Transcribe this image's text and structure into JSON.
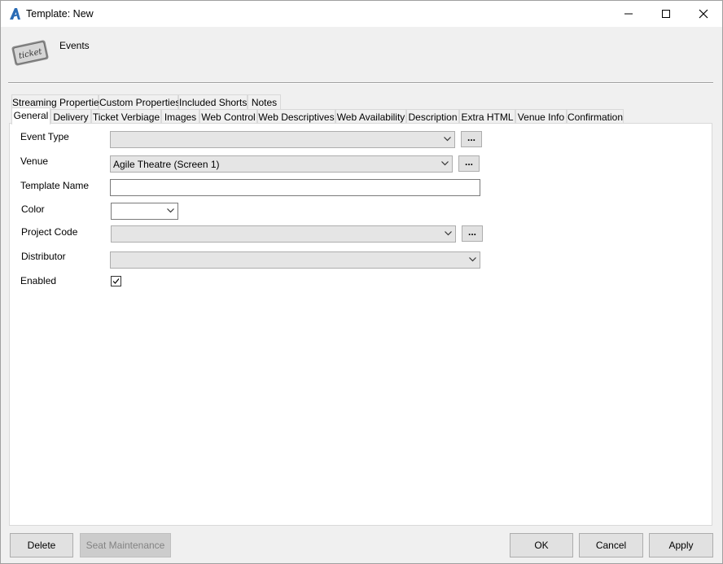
{
  "window": {
    "title": "Template: New",
    "controls": {
      "minimize": "minimize",
      "maximize": "maximize",
      "close": "close"
    }
  },
  "header": {
    "label": "Events",
    "icon": "ticket-icon",
    "icon_text": "ticket"
  },
  "tabs_row1": [
    {
      "label": "Streaming Properties"
    },
    {
      "label": "Custom Properties"
    },
    {
      "label": "Included Shorts"
    },
    {
      "label": "Notes"
    }
  ],
  "tabs_row2": [
    {
      "label": "General",
      "active": true
    },
    {
      "label": "Delivery"
    },
    {
      "label": "Ticket Verbiage"
    },
    {
      "label": "Images"
    },
    {
      "label": "Web Control"
    },
    {
      "label": "Web Descriptives"
    },
    {
      "label": "Web Availability"
    },
    {
      "label": "Description"
    },
    {
      "label": "Extra HTML"
    },
    {
      "label": "Venue Info"
    },
    {
      "label": "Confirmation"
    }
  ],
  "form": {
    "event_type": {
      "label": "Event Type",
      "value": "",
      "more": "..."
    },
    "venue": {
      "label": "Venue",
      "value": "Agile Theatre (Screen 1)",
      "more": "..."
    },
    "template_name": {
      "label": "Template Name",
      "value": ""
    },
    "color": {
      "label": "Color",
      "value": ""
    },
    "project_code": {
      "label": "Project Code",
      "value": "",
      "more": "..."
    },
    "distributor": {
      "label": "Distributor",
      "value": ""
    },
    "enabled": {
      "label": "Enabled",
      "checked": true
    }
  },
  "footer": {
    "delete": "Delete",
    "seat_maintenance": "Seat Maintenance",
    "ok": "OK",
    "cancel": "Cancel",
    "apply": "Apply"
  }
}
